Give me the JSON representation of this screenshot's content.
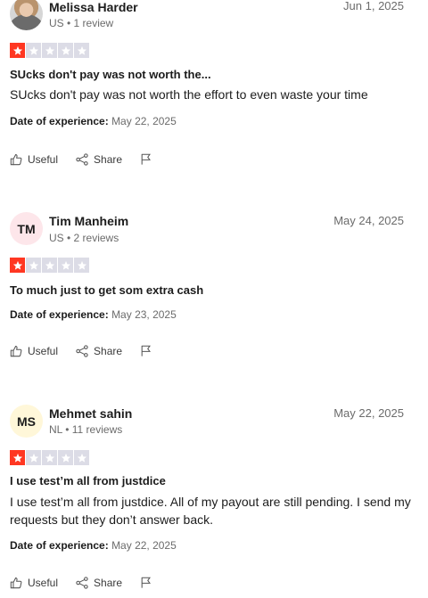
{
  "reviews": [
    {
      "name": "Melissa Harder",
      "meta": "US • 1 review",
      "date": "Jun 1, 2025",
      "avatar": "",
      "rating": 1,
      "title": "SUcks don't pay was not worth the...",
      "body": "SUcks don't pay was not worth the effort to even waste your time",
      "experience_label": "Date of experience:",
      "experience_date": "May 22, 2025"
    },
    {
      "name": "Tim Manheim",
      "meta": "US • 2 reviews",
      "date": "May 24, 2025",
      "avatar": "TM",
      "avatar_color": "#fde6ea",
      "rating": 1,
      "title": "To much just to get som extra cash",
      "body": "",
      "experience_label": "Date of experience:",
      "experience_date": "May 23, 2025"
    },
    {
      "name": "Mehmet sahin",
      "meta": "NL • 11 reviews",
      "date": "May 22, 2025",
      "avatar": "MS",
      "avatar_color": "#fff7d9",
      "rating": 1,
      "title": "I use test’m all from justdice",
      "body": "I use test’m all from justdice. All of my payout are still pending. I send my requests but they don’t answer back.",
      "experience_label": "Date of experience:",
      "experience_date": "May 22, 2025"
    }
  ],
  "actions": {
    "useful_label": "Useful",
    "share_label": "Share",
    "useful_icon": "thumbs-up-icon",
    "share_icon": "share-icon",
    "flag_icon": "flag-icon"
  },
  "colors": {
    "star_active": "#ff3722",
    "star_inactive": "#dcdce6",
    "text": "#1c1c1c",
    "muted": "#6b6b6b"
  }
}
